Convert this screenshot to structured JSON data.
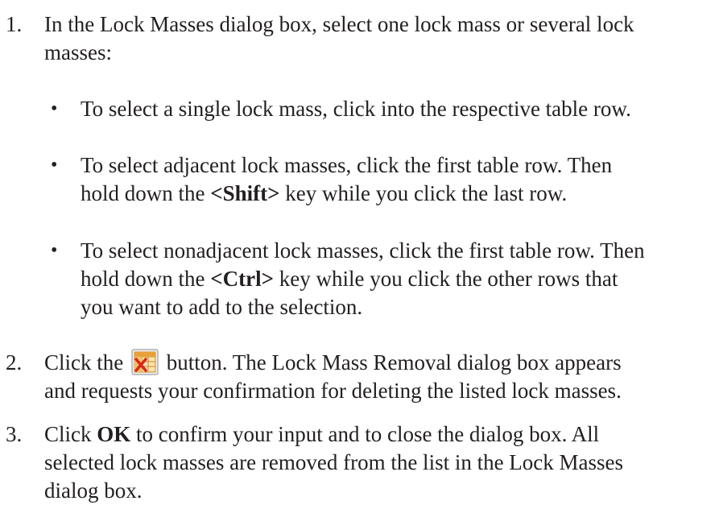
{
  "steps": [
    {
      "number": "1.",
      "line1": "In the Lock Masses dialog box, select one lock mass or several lock",
      "line2": "masses:"
    },
    {
      "number": "2.",
      "pre": "Click the",
      "icon": "remove-lock-masses-icon",
      "post": "button. The Lock Mass Removal dialog box appears",
      "line2": "and requests your confirmation for deleting the listed lock masses."
    },
    {
      "number": "3.",
      "pre": "Click",
      "bold": "OK",
      "post": "to confirm your input and to close the dialog box. All",
      "line2": "selected lock masses are removed from the list in the Lock Masses",
      "line3": "dialog box."
    }
  ],
  "bullets": [
    {
      "symbol": "•",
      "line1": "To select a single lock mass, click into the respective table row."
    },
    {
      "symbol": "•",
      "line1": "To select adjacent lock masses, click the first table row. Then",
      "line2_pre": "hold down the",
      "line2_key": "<Shift>",
      "line2_post": "key while you click the last row."
    },
    {
      "symbol": "•",
      "line1": "To select nonadjacent lock masses, click the first table row. Then",
      "line2_pre": "hold down the",
      "line2_key": "<Ctrl>",
      "line2_post": "key while you click the other rows that",
      "line3": "you want to add to the selection."
    }
  ],
  "colors": {
    "text": "#231f20",
    "icon_grid": "#e8a13a",
    "icon_x": "#d9261c"
  }
}
